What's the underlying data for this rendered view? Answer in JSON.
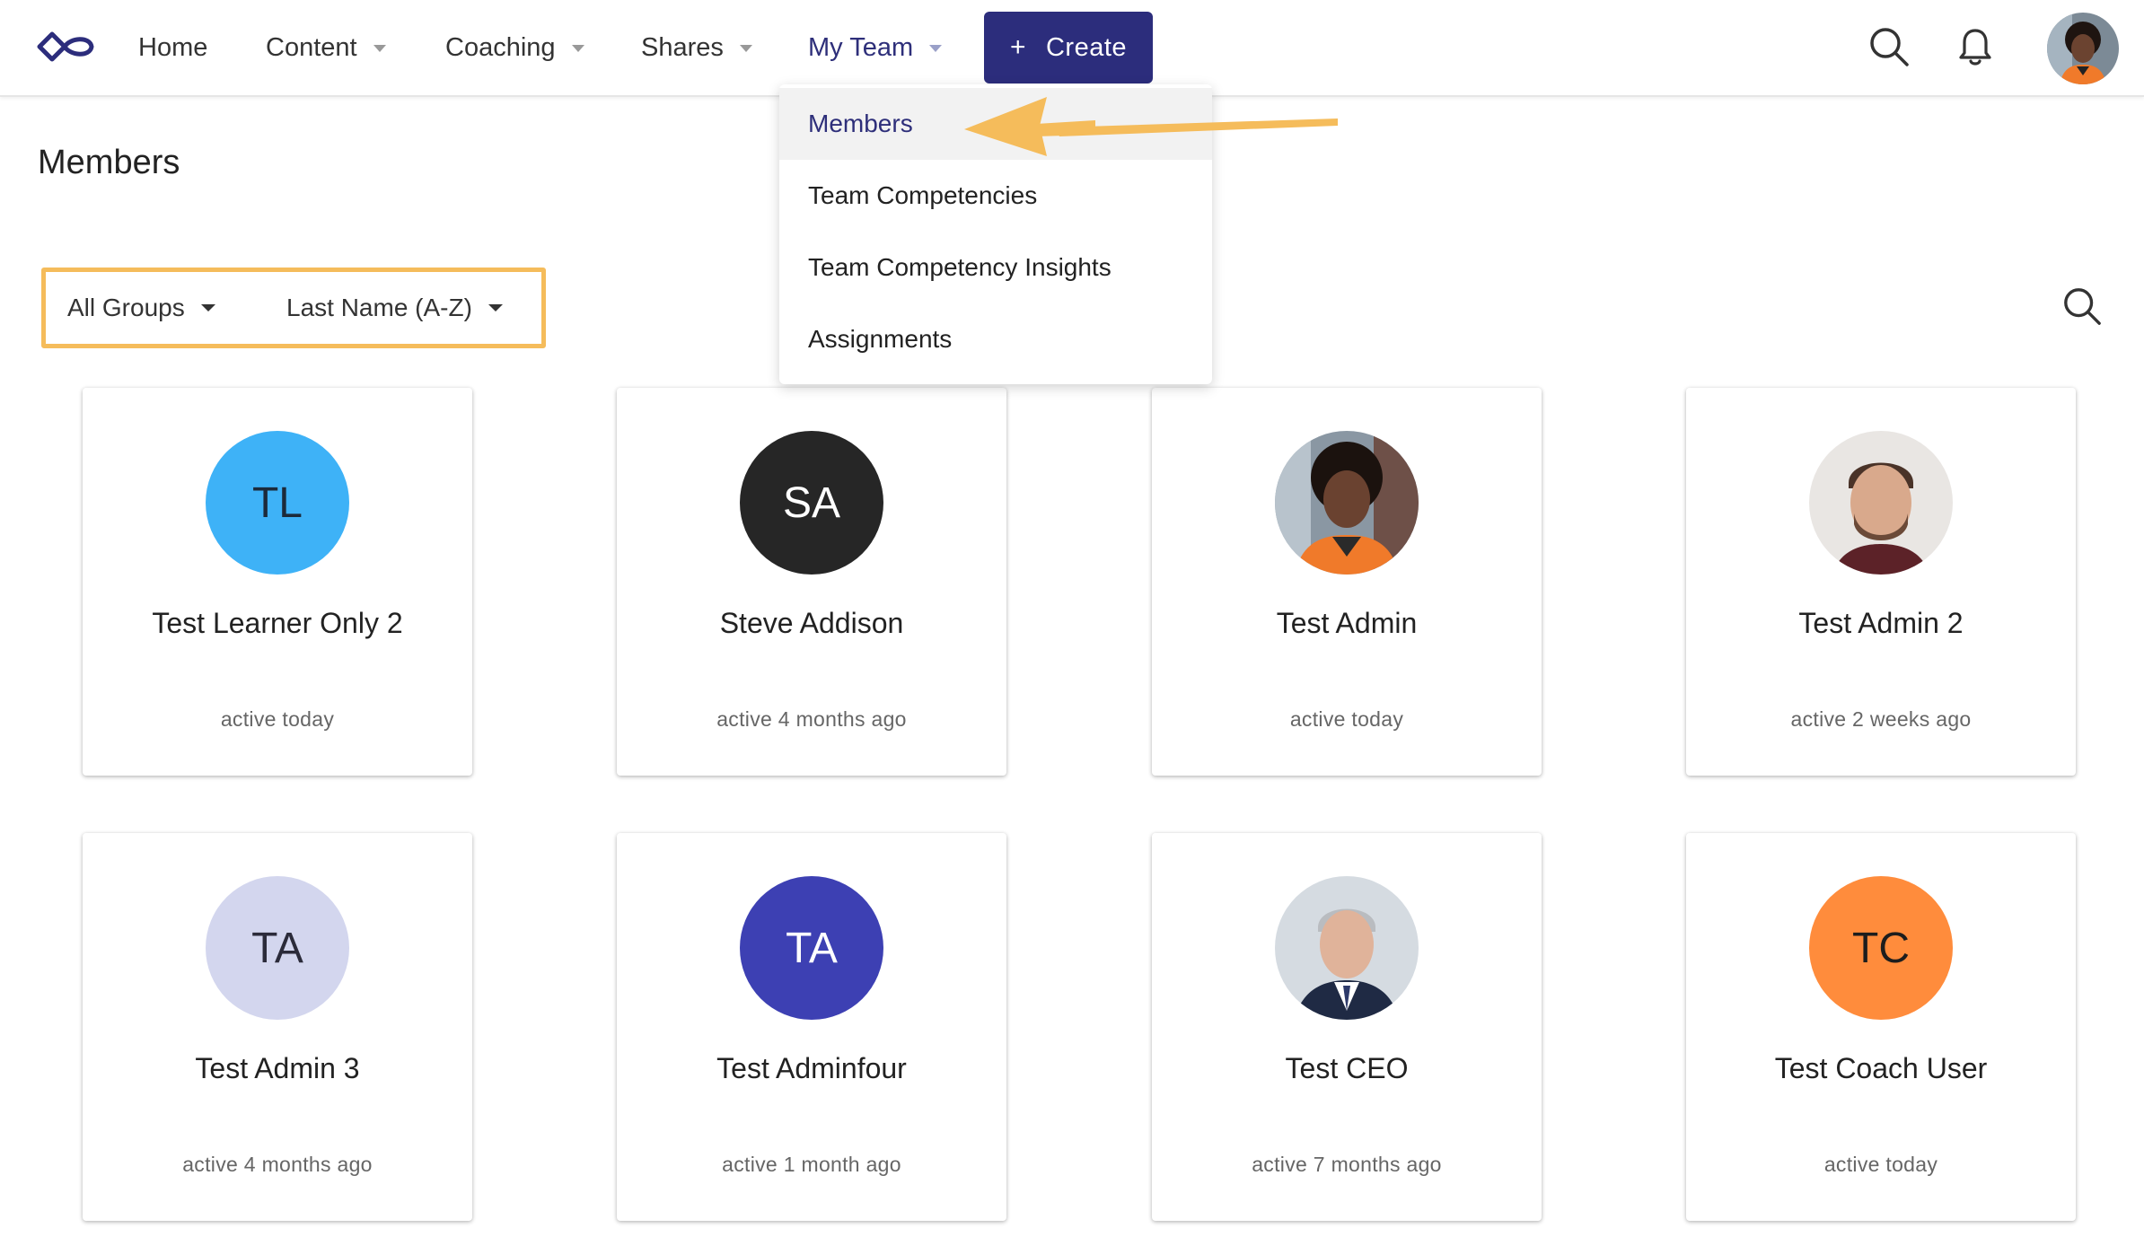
{
  "nav": {
    "items": [
      {
        "label": "Home"
      },
      {
        "label": "Content"
      },
      {
        "label": "Coaching"
      },
      {
        "label": "Shares"
      },
      {
        "label": "My Team"
      }
    ],
    "create_label": "Create",
    "brand_color": "#2c2d7c"
  },
  "dropdown": {
    "items": [
      "Members",
      "Team Competencies",
      "Team Competency Insights",
      "Assignments"
    ],
    "selected": "Members"
  },
  "page": {
    "title": "Members"
  },
  "filters": {
    "group": "All Groups",
    "sort": "Last Name (A-Z)",
    "highlight_color": "#f5bc5b"
  },
  "members": [
    {
      "name": "Test Learner Only 2",
      "initials": "TL",
      "status": "active today",
      "avatar_color": "#3eb2f7",
      "initials_color": "#1c2a3a"
    },
    {
      "name": "Steve Addison",
      "initials": "SA",
      "status": "active 4 months ago",
      "avatar_color": "#262626",
      "initials_color": "#ffffff"
    },
    {
      "name": "Test Admin",
      "initials": "",
      "status": "active today",
      "avatar_color": "#5a4a42",
      "initials_color": "#ffffff"
    },
    {
      "name": "Test Admin 2",
      "initials": "",
      "status": "active 2 weeks ago",
      "avatar_color": "#c9b6a6",
      "initials_color": "#ffffff"
    },
    {
      "name": "Test Admin 3",
      "initials": "TA",
      "status": "active 4 months ago",
      "avatar_color": "#d3d6ee",
      "initials_color": "#2b2b3a"
    },
    {
      "name": "Test Adminfour",
      "initials": "TA",
      "status": "active 1 month ago",
      "avatar_color": "#3d40b3",
      "initials_color": "#ffffff"
    },
    {
      "name": "Test CEO",
      "initials": "",
      "status": "active 7 months ago",
      "avatar_color": "#b9c4cf",
      "initials_color": "#ffffff"
    },
    {
      "name": "Test Coach User",
      "initials": "TC",
      "status": "active today",
      "avatar_color": "#ff8c3c",
      "initials_color": "#1d1d1d"
    }
  ]
}
